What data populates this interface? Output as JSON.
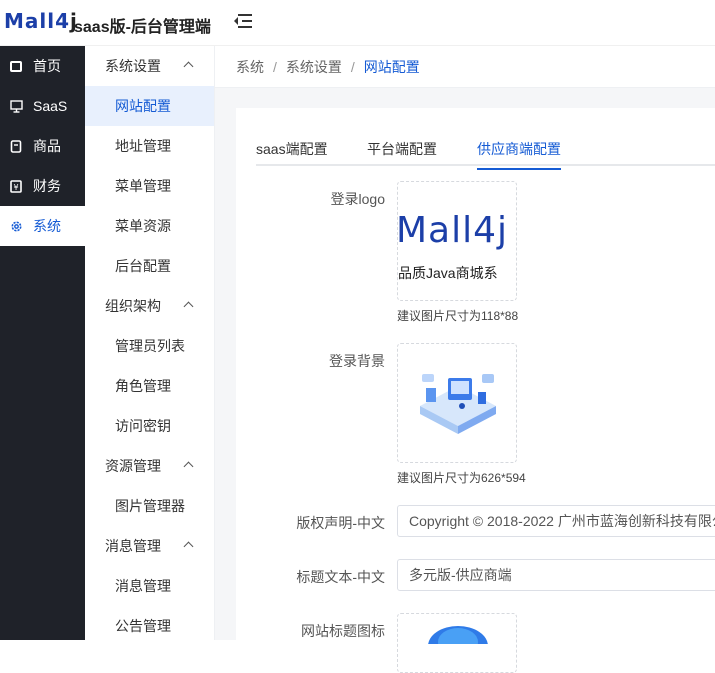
{
  "header": {
    "logo_main": "Mall4",
    "logo_j": "j",
    "title": "saas版-后台管理端"
  },
  "left_nav": {
    "items": [
      {
        "label": "首页",
        "icon": "monitor-icon"
      },
      {
        "label": "SaaS",
        "icon": "desktop-icon"
      },
      {
        "label": "商品",
        "icon": "product-icon"
      },
      {
        "label": "财务",
        "icon": "finance-icon"
      },
      {
        "label": "系统",
        "icon": "gear-icon",
        "active": true
      }
    ]
  },
  "sub_nav": {
    "groups": [
      {
        "title": "系统设置",
        "items": [
          "网站配置",
          "地址管理",
          "菜单管理",
          "菜单资源",
          "后台配置"
        ]
      },
      {
        "title": "组织架构",
        "items": [
          "管理员列表",
          "角色管理",
          "访问密钥"
        ]
      },
      {
        "title": "资源管理",
        "items": [
          "图片管理器"
        ]
      },
      {
        "title": "消息管理",
        "items": [
          "消息管理",
          "公告管理"
        ]
      }
    ],
    "active_item": "网站配置"
  },
  "breadcrumb": [
    "系统",
    "系统设置",
    "网站配置"
  ],
  "tabs": [
    {
      "label": "saas端配置"
    },
    {
      "label": "平台端配置"
    },
    {
      "label": "供应商端配置",
      "active": true
    }
  ],
  "form": {
    "login_logo_label": "登录logo",
    "login_logo_text": "Mall4j",
    "login_logo_sub": "品质Java商城系",
    "login_logo_hint": "建议图片尺寸为118*88",
    "login_bg_label": "登录背景",
    "login_bg_hint": "建议图片尺寸为626*594",
    "copyright_label": "版权声明-中文",
    "copyright_value": "Copyright © 2018-2022 广州市蓝海创新科技有限公",
    "title_text_label": "标题文本-中文",
    "title_text_value": "多元版-供应商端",
    "site_icon_label": "网站标题图标"
  },
  "colors": {
    "accent": "#155bd4",
    "nav_bg": "#1f2229",
    "content_bg": "#f5f6f8"
  }
}
